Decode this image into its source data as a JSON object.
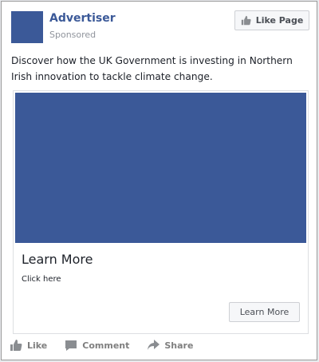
{
  "header": {
    "advertiser": "Advertiser",
    "sponsored": "Sponsored",
    "like_page_label": "Like Page"
  },
  "post": {
    "text": "Discover how the UK Government is investing in Northern Irish innovation to tackle climate change."
  },
  "attachment": {
    "headline": "Learn More",
    "subtitle": "Click here",
    "cta_label": "Learn More"
  },
  "actions": {
    "like": "Like",
    "comment": "Comment",
    "share": "Share"
  },
  "colors": {
    "brand": "#3b5998",
    "image_placeholder": "#3b5998"
  }
}
